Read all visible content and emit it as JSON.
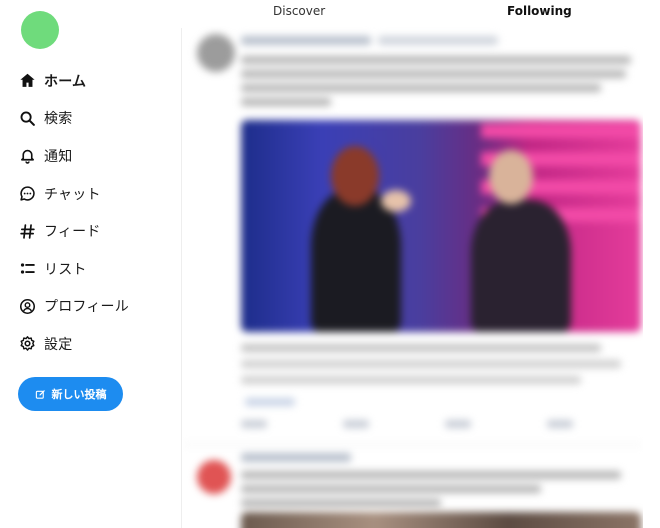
{
  "sidebar": {
    "items": [
      {
        "label": "ホーム",
        "icon": "home-icon"
      },
      {
        "label": "検索",
        "icon": "search-icon"
      },
      {
        "label": "通知",
        "icon": "bell-icon"
      },
      {
        "label": "チャット",
        "icon": "chat-icon"
      },
      {
        "label": "フィード",
        "icon": "hashtag-icon"
      },
      {
        "label": "リスト",
        "icon": "list-icon"
      },
      {
        "label": "プロフィール",
        "icon": "profile-icon"
      },
      {
        "label": "設定",
        "icon": "gear-icon"
      }
    ],
    "compose_label": "新しい投稿",
    "avatar_color": "#6fdb7c",
    "compose_color": "#1d8cf0"
  },
  "tabs": [
    {
      "label": "Discover",
      "active": false
    },
    {
      "label": "Following",
      "active": true
    }
  ]
}
